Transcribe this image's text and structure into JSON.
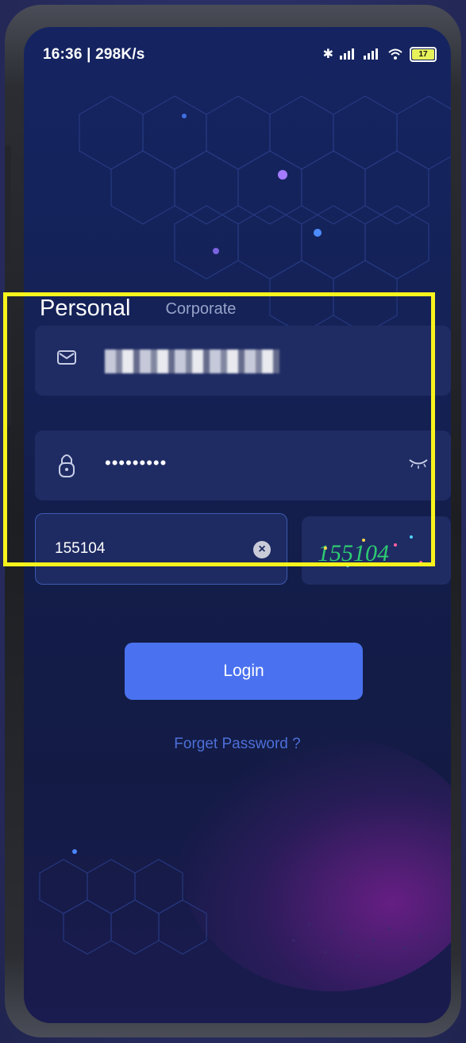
{
  "status_bar": {
    "time_speed": "16:36 | 298K/s",
    "battery": "17"
  },
  "tabs": [
    {
      "label": "Personal",
      "active": true
    },
    {
      "label": "Corporate",
      "active": false
    }
  ],
  "form": {
    "email_icon": "mail-icon",
    "password_icon": "lock-icon",
    "password_value": "•••••••••",
    "eye_icon": "eye-closed-icon",
    "captcha_value": "155104",
    "clear_icon": "clear-icon",
    "captcha_image_text": "155104"
  },
  "actions": {
    "login_label": "Login",
    "forget_label": "Forget Password ?"
  },
  "colors": {
    "highlight": "#f7f31c",
    "login_button": "#4a72f0",
    "link": "#4d6fd8"
  }
}
